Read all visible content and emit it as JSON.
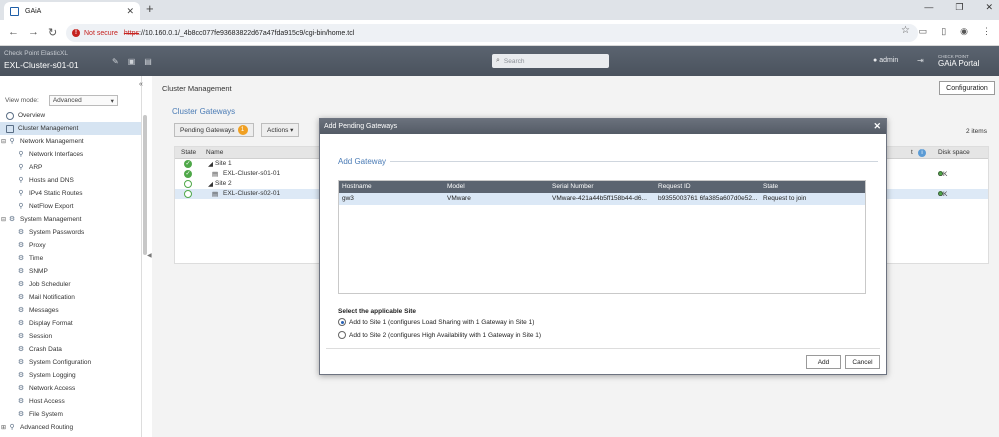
{
  "browser": {
    "tab_title": "GAiA",
    "not_secure": "Not secure",
    "url_proto": "https",
    "url_rest": "://10.160.0.1/_4b8cc077fe93683822d67a47fda915c9/cgi-bin/home.tcl"
  },
  "header": {
    "brand_sub": "Check Point ElasticXL",
    "brand_main": "EXL-Cluster-s01-01",
    "search_placeholder": "Search",
    "user": "admin",
    "logo_small": "CHECK POINT",
    "logo_large": "GAiA Portal"
  },
  "sidebar": {
    "view_mode_label": "View mode:",
    "view_mode_value": "Advanced",
    "items": [
      {
        "label": "Overview",
        "level": 1
      },
      {
        "label": "Cluster Management",
        "level": 1,
        "selected": true
      },
      {
        "label": "Network Management",
        "level": 0
      },
      {
        "label": "Network Interfaces",
        "level": 2
      },
      {
        "label": "ARP",
        "level": 2
      },
      {
        "label": "Hosts and DNS",
        "level": 2
      },
      {
        "label": "IPv4 Static Routes",
        "level": 2
      },
      {
        "label": "NetFlow Export",
        "level": 2
      },
      {
        "label": "System Management",
        "level": 0
      },
      {
        "label": "System Passwords",
        "level": 2
      },
      {
        "label": "Proxy",
        "level": 2
      },
      {
        "label": "Time",
        "level": 2
      },
      {
        "label": "SNMP",
        "level": 2
      },
      {
        "label": "Job Scheduler",
        "level": 2
      },
      {
        "label": "Mail Notification",
        "level": 2
      },
      {
        "label": "Messages",
        "level": 2
      },
      {
        "label": "Display Format",
        "level": 2
      },
      {
        "label": "Session",
        "level": 2
      },
      {
        "label": "Crash Data",
        "level": 2
      },
      {
        "label": "System Configuration",
        "level": 2
      },
      {
        "label": "System Logging",
        "level": 2
      },
      {
        "label": "Network Access",
        "level": 2
      },
      {
        "label": "Host Access",
        "level": 2
      },
      {
        "label": "File System",
        "level": 2
      },
      {
        "label": "Advanced Routing",
        "level": 0
      }
    ]
  },
  "main": {
    "page_title": "Cluster Management",
    "config_button": "Configuration",
    "section_title": "Cluster Gateways",
    "pending_button": "Pending Gateways",
    "pending_count": "1",
    "actions_button": "Actions",
    "items_count": "2 items",
    "grid": {
      "col_state": "State",
      "col_name": "Name",
      "col_t": "t",
      "col_disk": "Disk space",
      "rows": [
        {
          "name": "Site 1",
          "state": "ok",
          "disk": ""
        },
        {
          "name": "EXL-Cluster-s01-01",
          "state": "ok",
          "disk": "OK"
        },
        {
          "name": "Site 2",
          "state": "empty",
          "disk": ""
        },
        {
          "name": "EXL-Cluster-s02-01",
          "state": "empty",
          "disk": "OK"
        }
      ]
    }
  },
  "modal": {
    "title": "Add Pending Gateways",
    "section_title": "Add Gateway",
    "columns": [
      "Hostname",
      "Model",
      "Serial Number",
      "Request ID",
      "State"
    ],
    "rows": [
      {
        "hostname": "gw3",
        "model": "VMware",
        "serial": "VMware-421a44b5ff158b44-d6...",
        "request_id": "b9355003761 6fa385a607d0e52...",
        "state": "Request to join"
      }
    ],
    "site_label": "Select the applicable Site",
    "option1": "Add to Site 1 (configures Load Sharing with 1 Gateway in Site 1)",
    "option2": "Add to Site 2 (configures High Availability with 1 Gateway in Site 1)",
    "add_button": "Add",
    "cancel_button": "Cancel"
  },
  "colors": {
    "accent_blue": "#4a7bb5",
    "header_gray": "#5b6470",
    "ok_green": "#4fa849",
    "badge_orange": "#f0a023",
    "selection_blue": "#dbe8f6"
  }
}
